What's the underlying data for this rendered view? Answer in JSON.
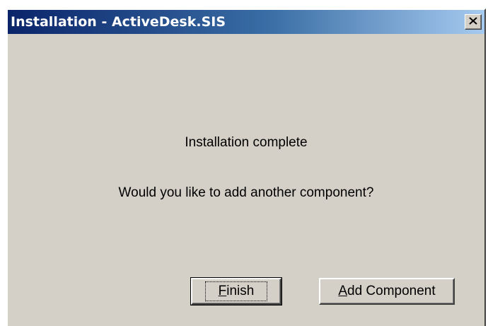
{
  "window": {
    "title": "Installation - ActiveDesk.SIS"
  },
  "message": {
    "line1": "Installation complete",
    "line2": "Would you like to add another component?"
  },
  "buttons": {
    "finish": {
      "mnemonic": "F",
      "rest": "inish"
    },
    "add_component": {
      "mnemonic": "A",
      "rest": "dd Component"
    }
  },
  "icons": {
    "close": "close-icon"
  },
  "colors": {
    "titlebar_start": "#0a246a",
    "titlebar_end": "#a6caf0",
    "dialog_face": "#d4d0c8"
  }
}
